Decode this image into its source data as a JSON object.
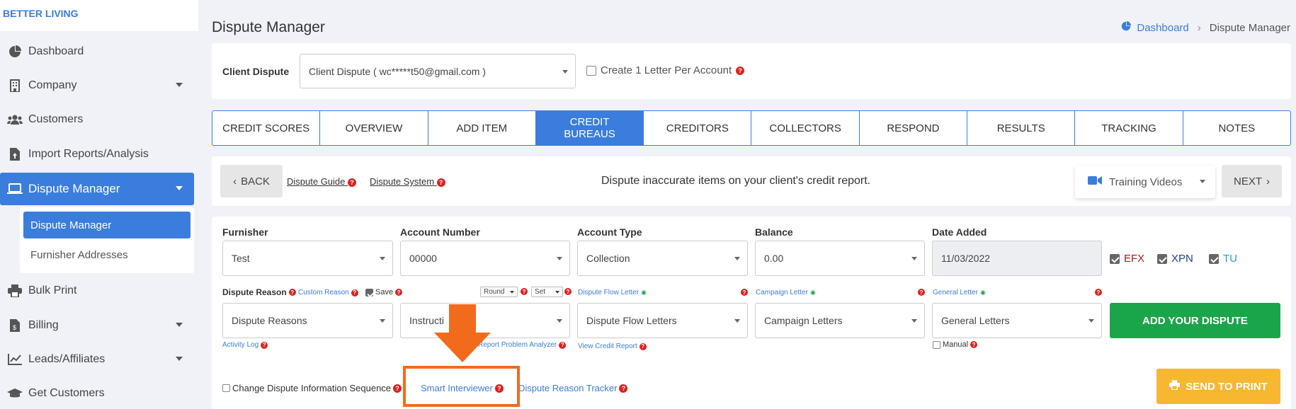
{
  "brand": "BETTER LIVING",
  "sidebar": {
    "items": [
      {
        "label": "Dashboard",
        "icon": "pie-chart-icon"
      },
      {
        "label": "Company",
        "icon": "building-icon"
      },
      {
        "label": "Customers",
        "icon": "users-icon"
      },
      {
        "label": "Import Reports/Analysis",
        "icon": "file-upload-icon"
      },
      {
        "label": "Dispute Manager",
        "icon": "laptop-icon"
      },
      {
        "label": "Bulk Print",
        "icon": "print-icon"
      },
      {
        "label": "Billing",
        "icon": "invoice-icon"
      },
      {
        "label": "Leads/Affiliates",
        "icon": "chart-line-icon"
      },
      {
        "label": "Get Customers",
        "icon": "graduation-cap-icon"
      }
    ],
    "submenu": [
      "Dispute Manager",
      "Furnisher Addresses"
    ]
  },
  "page": {
    "title": "Dispute Manager",
    "breadcrumb_home": "Dashboard",
    "breadcrumb_current": "Dispute Manager"
  },
  "client": {
    "label": "Client Dispute",
    "value": "Client Dispute ( wc*****t50@gmail.com )",
    "one_letter_label": "Create 1 Letter Per Account"
  },
  "tabs": [
    "CREDIT SCORES",
    "OVERVIEW",
    "ADD ITEM",
    "CREDIT BUREAUS",
    "CREDITORS",
    "COLLECTORS",
    "RESPOND",
    "RESULTS",
    "TRACKING",
    "NOTES"
  ],
  "actions": {
    "back": "BACK",
    "guide": "Dispute Guide",
    "system": "Dispute System",
    "center": "Dispute inaccurate items on your client's credit report.",
    "training": "Training Videos",
    "next": "NEXT"
  },
  "form": {
    "furnisher_label": "Furnisher",
    "furnisher_value": "Test",
    "account_number_label": "Account Number",
    "account_number_value": "00000",
    "account_type_label": "Account Type",
    "account_type_value": "Collection",
    "balance_label": "Balance",
    "balance_value": "0.00",
    "date_added_label": "Date Added",
    "date_added_value": "11/03/2022",
    "efx": "EFX",
    "xpn": "XPN",
    "tu": "TU",
    "dispute_reason_label": "Dispute Reason",
    "custom_reason": "Custom Reason",
    "save": "Save",
    "round": "Round",
    "set": "Set",
    "flow_letter_label": "Dispute Flow Letter",
    "campaign_letter_label": "Campaign Letter",
    "general_letter_label": "General Letter",
    "dispute_reasons": "Dispute Reasons",
    "instructions": "Instructi",
    "flow_letters": "Dispute Flow Letters",
    "campaign_letters": "Campaign Letters",
    "general_letters": "General Letters",
    "add_dispute": "ADD YOUR DISPUTE",
    "activity_log": "Activity Log",
    "report_problem": "Report Problem Analyzer",
    "view_credit_report": "View Credit Report",
    "manual": "Manual",
    "change_sequence": "Change Dispute Information Sequence",
    "smart_interviewer": "Smart Interviewer",
    "reason_tracker": "Dispute Reason Tracker",
    "send_to_print": "SEND TO PRINT"
  },
  "colors": {
    "accent": "#3b7ddd",
    "green": "#1aa54a",
    "orange": "#f7b731",
    "highlight": "#f26b1d",
    "efx": "#9b1c1c",
    "xpn": "#1f3f8f",
    "tu": "#1a9fd0"
  }
}
